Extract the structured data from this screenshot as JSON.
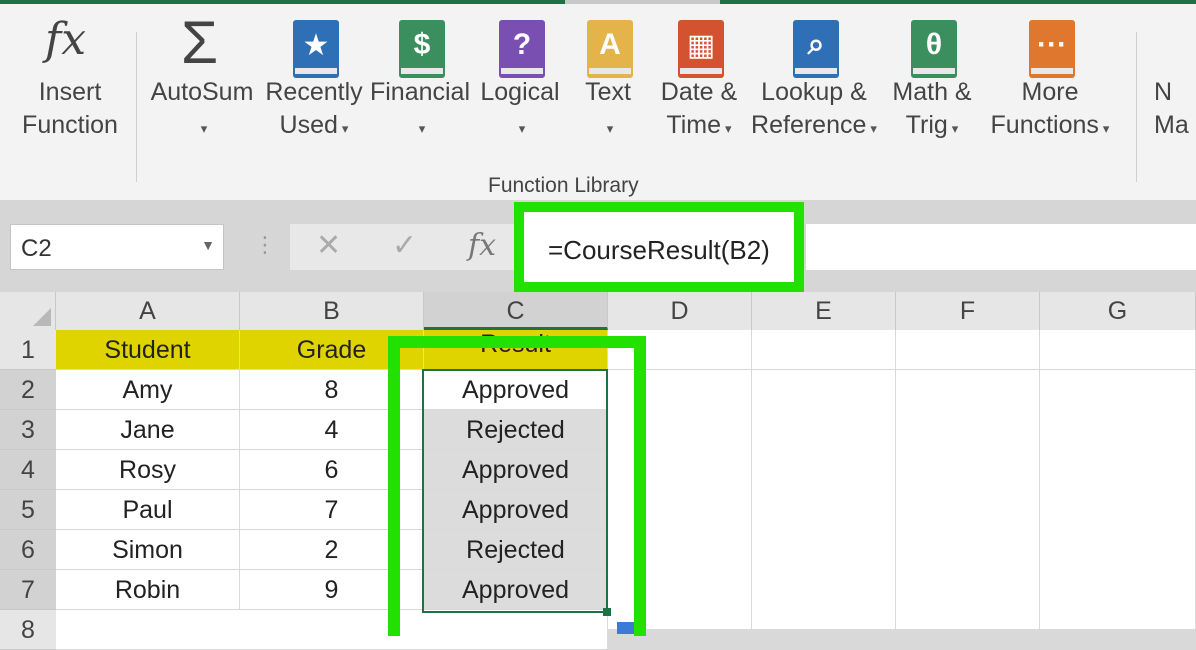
{
  "ribbon": {
    "buttons": [
      {
        "id": "insert-function",
        "line1": "Insert",
        "line2": "Function",
        "icon": "fx-icon",
        "icon_text": "fx"
      },
      {
        "id": "autosum",
        "line1": "AutoSum",
        "line2": "",
        "icon": "sigma-icon",
        "icon_text": "Σ"
      },
      {
        "id": "recently-used",
        "line1": "Recently",
        "line2": "Used",
        "icon": "star-book-icon",
        "icon_text": "★",
        "color": "#2e6fb6"
      },
      {
        "id": "financial",
        "line1": "Financial",
        "line2": "",
        "icon": "coins-book-icon",
        "icon_text": "$",
        "color": "#3b8f5e"
      },
      {
        "id": "logical",
        "line1": "Logical",
        "line2": "",
        "icon": "question-book-icon",
        "icon_text": "?",
        "color": "#7a4fb2"
      },
      {
        "id": "text",
        "line1": "Text",
        "line2": "",
        "icon": "text-book-icon",
        "icon_text": "A",
        "color": "#e4b34a"
      },
      {
        "id": "date-time",
        "line1": "Date &",
        "line2": "Time",
        "icon": "calendar-book-icon",
        "icon_text": "▦",
        "color": "#d35230"
      },
      {
        "id": "lookup-reference",
        "line1": "Lookup &",
        "line2": "Reference",
        "icon": "magnifier-book-icon",
        "icon_text": "⌕",
        "color": "#2e6fb6"
      },
      {
        "id": "math-trig",
        "line1": "Math &",
        "line2": "Trig",
        "icon": "theta-book-icon",
        "icon_text": "θ",
        "color": "#3b8f5e"
      },
      {
        "id": "more-functions",
        "line1": "More",
        "line2": "Functions",
        "icon": "dots-book-icon",
        "icon_text": "···",
        "color": "#e0772f"
      },
      {
        "id": "name-manager",
        "line1": "N",
        "line2": "Ma",
        "icon": "name-manager-icon",
        "icon_text": ""
      }
    ],
    "group_label": "Function Library"
  },
  "formula_bar": {
    "name_box": "C2",
    "cancel_glyph": "✕",
    "enter_glyph": "✓",
    "fx_glyph": "fx",
    "formula": "=CourseResult(B2)"
  },
  "grid": {
    "columns": [
      "A",
      "B",
      "C",
      "D",
      "E",
      "F",
      "G"
    ],
    "rows": [
      "1",
      "2",
      "3",
      "4",
      "5",
      "6",
      "7",
      "8"
    ],
    "header_row": {
      "a": "Student",
      "b": "Grade",
      "c": "Result"
    },
    "data": [
      {
        "name": "Amy",
        "grade": "8",
        "result": "Approved"
      },
      {
        "name": "Jane",
        "grade": "4",
        "result": "Rejected"
      },
      {
        "name": "Rosy",
        "grade": "6",
        "result": "Approved"
      },
      {
        "name": "Paul",
        "grade": "7",
        "result": "Approved"
      },
      {
        "name": "Simon",
        "grade": "2",
        "result": "Rejected"
      },
      {
        "name": "Robin",
        "grade": "9",
        "result": "Approved"
      }
    ]
  },
  "colors": {
    "excel_green": "#1e7145",
    "highlight_green": "#22e000",
    "header_yellow": "#e0d400"
  }
}
